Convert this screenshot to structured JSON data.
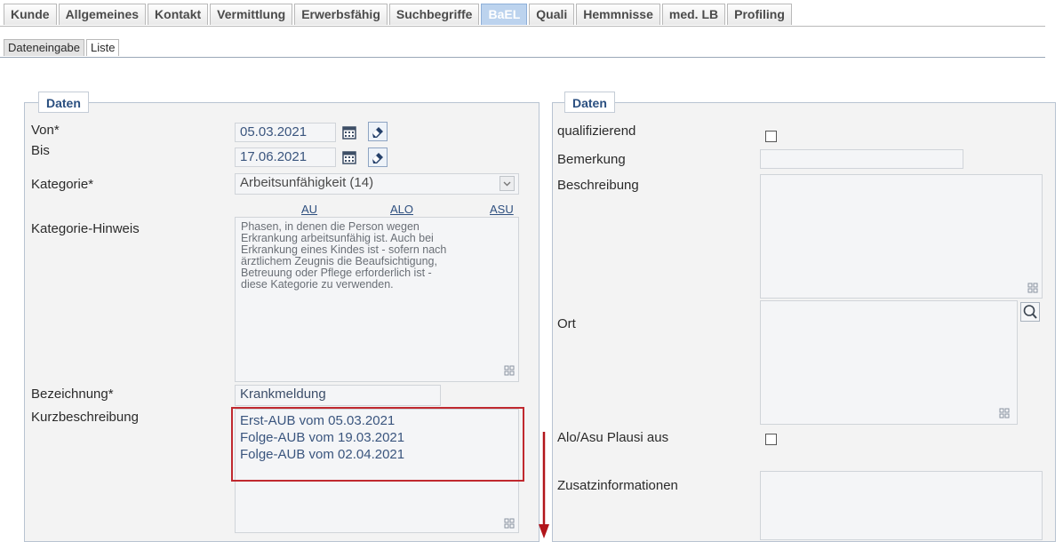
{
  "tabs": [
    "Kunde",
    "Allgemeines",
    "Kontakt",
    "Vermittlung",
    "Erwerbsfähig",
    "Suchbegriffe",
    "BaEL",
    "Quali",
    "Hemmnisse",
    "med. LB",
    "Profiling"
  ],
  "active_tab": "BaEL",
  "subtabs": [
    "Dateneingabe",
    "Liste"
  ],
  "left_panel": {
    "legend": "Daten",
    "von_label": "Von*",
    "von_value": "05.03.2021",
    "bis_label": "Bis",
    "bis_value": "17.06.2021",
    "kategorie_label": "Kategorie*",
    "kategorie_value": "Arbeitsunfähigkeit (14)",
    "links": [
      "AU",
      "ALO",
      "ASU"
    ],
    "hinweis_label": "Kategorie-Hinweis",
    "hinweis_text": "Phasen, in denen die Person wegen\nErkrankung arbeitsunfähig ist. Auch bei\nErkrankung eines Kindes ist - sofern nach\närztlichem Zeugnis die Beaufsichtigung,\nBetreuung oder Pflege erforderlich ist -\ndiese Kategorie zu verwenden.",
    "bezeichnung_label": "Bezeichnung*",
    "bezeichnung_value": "Krankmeldung",
    "kurzbeschreibung_label": "Kurzbeschreibung",
    "kurzbeschreibung_lines": [
      "Erst-AUB vom 05.03.2021",
      "Folge-AUB vom 19.03.2021",
      "Folge-AUB vom 02.04.2021"
    ]
  },
  "right_panel": {
    "legend": "Daten",
    "qualifizierend_label": "qualifizierend",
    "bemerkung_label": "Bemerkung",
    "beschreibung_label": "Beschreibung",
    "ort_label": "Ort",
    "alo_asu_label": "Alo/Asu Plausi aus",
    "zusatz_label": "Zusatzinformationen"
  },
  "colors": {
    "highlight_box": "#c0292f",
    "arrow": "#b2151b",
    "active_tab_bg": "#bcd3ee"
  },
  "icons": [
    "calendar-icon",
    "eraser-icon",
    "dropdown-arrow-icon",
    "resize-handle-icon",
    "search-icon"
  ]
}
